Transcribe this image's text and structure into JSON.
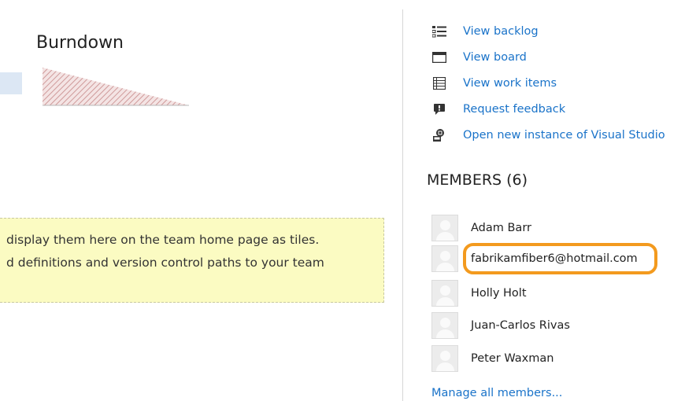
{
  "burndown": {
    "title": "Burndown"
  },
  "tip": {
    "line1": "display them here on the team home page as tiles.",
    "line2": "d definitions and version control paths to your team"
  },
  "actions": [
    {
      "label": "View backlog",
      "icon": "backlog-list-icon"
    },
    {
      "label": "View board",
      "icon": "board-icon"
    },
    {
      "label": "View work items",
      "icon": "work-items-icon"
    },
    {
      "label": "Request feedback",
      "icon": "feedback-icon"
    },
    {
      "label": "Open new instance of Visual Studio",
      "icon": "visual-studio-icon"
    }
  ],
  "members": {
    "heading": "MEMBERS (6)",
    "list": [
      {
        "name": "Adam Barr"
      },
      {
        "name": "fabrikamfiber6@hotmail.com"
      },
      {
        "name": "Holly Holt"
      },
      {
        "name": "Juan-Carlos Rivas"
      },
      {
        "name": "Peter Waxman"
      }
    ],
    "manage_label": "Manage all members..."
  },
  "colors": {
    "link": "#1a73c9",
    "highlight": "#f39a1e",
    "tip_background": "#fbfbc2"
  }
}
